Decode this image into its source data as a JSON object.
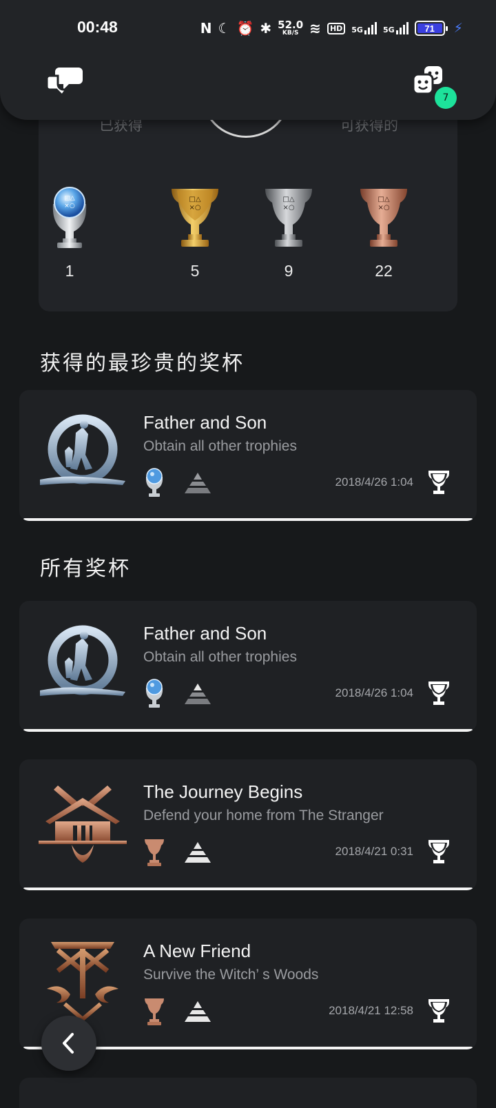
{
  "status_bar": {
    "time": "00:48",
    "speed_value": "52.0",
    "speed_unit": "KB/S",
    "hd_label": "HD",
    "net1": "5G",
    "net2": "5G",
    "battery": "71"
  },
  "header": {
    "friends_badge": "7"
  },
  "summary": {
    "earned_label": "已获得",
    "available_label": "可获得的",
    "counts": [
      {
        "grade": "platinum",
        "count": "1"
      },
      {
        "grade": "gold",
        "count": "5"
      },
      {
        "grade": "silver",
        "count": "9"
      },
      {
        "grade": "bronze",
        "count": "22"
      }
    ]
  },
  "sections": {
    "rarest_title": "获得的最珍贵的奖杯",
    "all_title": "所有奖杯"
  },
  "rarest": {
    "name": "Father and Son",
    "description": "Obtain all other trophies",
    "grade": "platinum",
    "date": "2018/4/26  1:04"
  },
  "trophies": [
    {
      "name": "Father and Son",
      "description": "Obtain all other trophies",
      "grade": "platinum",
      "date": "2018/4/26  1:04"
    },
    {
      "name": "The Journey Begins",
      "description": "Defend your home from The Stranger",
      "grade": "bronze",
      "date": "2018/4/21  0:31"
    },
    {
      "name": "A New Friend",
      "description": "Survive the Witch’ s Woods",
      "grade": "bronze",
      "date": "2018/4/21  12:58"
    }
  ],
  "colors": {
    "background": "#17191b",
    "card": "#1f2124",
    "badge": "#1de29b",
    "platinum": "#9fc8ee",
    "gold": "#d4a02a",
    "silver": "#a9abae",
    "bronze": "#c07d62"
  }
}
